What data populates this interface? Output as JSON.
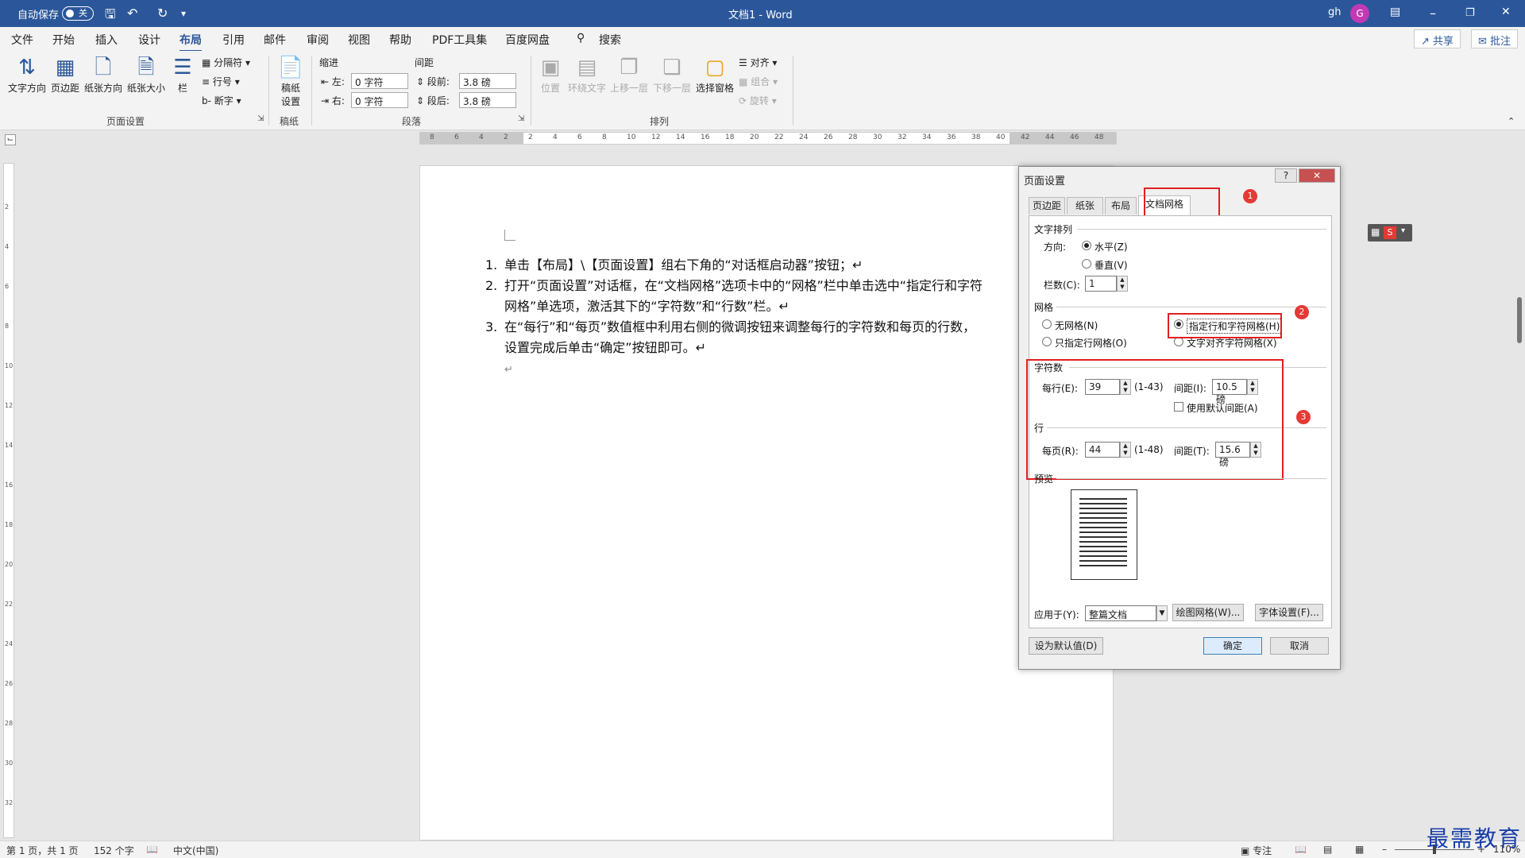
{
  "titlebar": {
    "autosave": "自动保存",
    "toggle": "关",
    "doc_title": "文档1",
    "sep": " - ",
    "app": "Word",
    "user": "gh",
    "avatar": "G"
  },
  "menu": [
    "文件",
    "开始",
    "插入",
    "设计",
    "布局",
    "引用",
    "邮件",
    "审阅",
    "视图",
    "帮助",
    "PDF工具集",
    "百度网盘"
  ],
  "search": "搜索",
  "share": "共享",
  "comments": "批注",
  "ribbon": {
    "text_dir": "文字方向",
    "margins": "页边距",
    "orientation": "纸张方向",
    "size": "纸张大小",
    "columns": "栏",
    "breaks": "分隔符",
    "line_numbers": "行号",
    "hyphenation": "断字",
    "page_setup": "页面设置",
    "draft": "稿纸\n设置",
    "draft_grp": "稿纸",
    "indent": "缩进",
    "spacing": "间距",
    "left": "左:",
    "right": "右:",
    "before": "段前:",
    "after": "段后:",
    "left_val": "0 字符",
    "right_val": "0 字符",
    "before_val": "3.8 磅",
    "after_val": "3.8 磅",
    "paragraph": "段落",
    "position": "位置",
    "wrap": "环绕文字",
    "forward": "上移一层",
    "backward": "下移一层",
    "selection": "选择窗格",
    "align": "对齐",
    "group": "组合",
    "rotate": "旋转",
    "arrange": "排列"
  },
  "hruler_ticks": [
    "8",
    "6",
    "4",
    "2",
    "2",
    "4",
    "6",
    "8",
    "10",
    "12",
    "14",
    "16",
    "18",
    "20",
    "22",
    "24",
    "26",
    "28",
    "30",
    "32",
    "34",
    "36",
    "38",
    "40",
    "42",
    "44",
    "46",
    "48"
  ],
  "vruler_ticks": [
    "2",
    "4",
    "6",
    "8",
    "10",
    "12",
    "14",
    "16",
    "18",
    "20",
    "22",
    "24",
    "26",
    "28",
    "30",
    "32"
  ],
  "doc": {
    "items": [
      {
        "num": "1.",
        "text": "单击【布局】\\【页面设置】组右下角的“对话框启动器”按钮；↵"
      },
      {
        "num": "2.",
        "text": "打开“页面设置”对话框，在“文档网格”选项卡中的“网格”栏中单击选中“指定行和字符网格”单选项，激活其下的“字符数”和“行数”栏。↵"
      },
      {
        "num": "3.",
        "text": "在“每行”和“每页”数值框中利用右侧的微调按钮来调整每行的字符数和每页的行数，设置完成后单击“确定”按钮即可。↵"
      }
    ],
    "empty_para": "↵"
  },
  "dialog": {
    "title": "页面设置",
    "help": "?",
    "close": "✕",
    "tabs": [
      "页边距",
      "纸张",
      "布局",
      "文档网格"
    ],
    "text_dir_label": "文字排列",
    "direction": "方向:",
    "horizontal": "水平(Z)",
    "vertical": "垂直(V)",
    "columns_label": "栏数(C):",
    "columns_val": "1",
    "grid_label": "网格",
    "no_grid": "无网格(N)",
    "line_grid_only": "只指定行网格(O)",
    "line_char_grid": "指定行和字符网格(H)",
    "snap_char": "文字对齐字符网格(X)",
    "chars_label": "字符数",
    "per_line": "每行(E):",
    "per_line_val": "39",
    "per_line_range": "(1-43)",
    "pitch": "间距(I):",
    "pitch_val": "10.5 磅",
    "default_pitch": "使用默认间距(A)",
    "lines_label": "行",
    "per_page": "每页(R):",
    "per_page_val": "44",
    "per_page_range": "(1-48)",
    "line_pitch": "间距(T):",
    "line_pitch_val": "15.6 磅",
    "preview": "预览",
    "apply_to": "应用于(Y):",
    "apply_val": "整篇文档",
    "draw_grid": "绘图网格(W)...",
    "font_settings": "字体设置(F)...",
    "set_default": "设为默认值(D)",
    "ok": "确定",
    "cancel": "取消",
    "badges": [
      "1",
      "2",
      "3"
    ]
  },
  "status": {
    "page": "第 1 页，共 1 页",
    "words": "152 个字",
    "lang": "中文(中国)",
    "focus": "专注",
    "zoom": "110%"
  },
  "watermark": "最需教育"
}
